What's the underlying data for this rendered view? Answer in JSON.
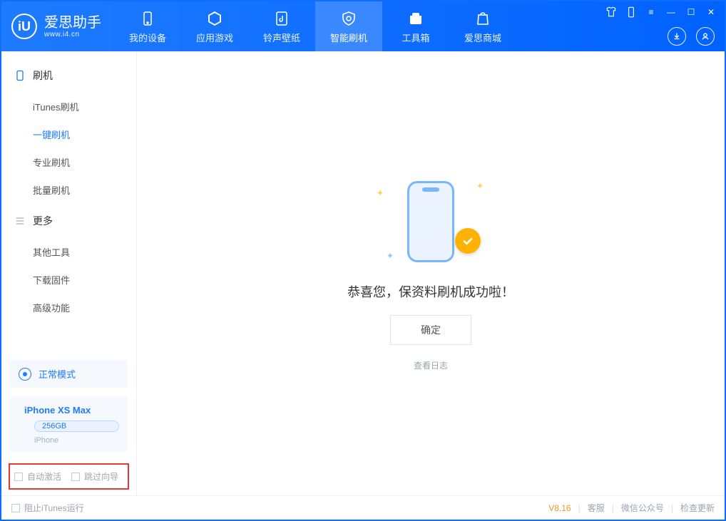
{
  "app": {
    "name": "爱思助手",
    "url": "www.i4.cn",
    "logo_letter": "iU"
  },
  "nav": {
    "items": [
      {
        "label": "我的设备",
        "icon": "phone-icon"
      },
      {
        "label": "应用游戏",
        "icon": "cube-icon"
      },
      {
        "label": "铃声壁纸",
        "icon": "music-icon"
      },
      {
        "label": "智能刷机",
        "icon": "refresh-shield-icon"
      },
      {
        "label": "工具箱",
        "icon": "toolbox-icon"
      },
      {
        "label": "爱思商城",
        "icon": "bag-icon"
      }
    ],
    "active_index": 3
  },
  "sidebar": {
    "group1_label": "刷机",
    "group1_items": [
      "iTunes刷机",
      "一键刷机",
      "专业刷机",
      "批量刷机"
    ],
    "group1_active_index": 1,
    "group2_label": "更多",
    "group2_items": [
      "其他工具",
      "下载固件",
      "高级功能"
    ]
  },
  "mode_card": {
    "label": "正常模式"
  },
  "device_card": {
    "name": "iPhone XS Max",
    "capacity": "256GB",
    "type": "iPhone"
  },
  "options": {
    "opt1": "自动激活",
    "opt2": "跳过向导"
  },
  "main": {
    "success_text": "恭喜您，保资料刷机成功啦！",
    "ok_button": "确定",
    "log_link": "查看日志"
  },
  "footer": {
    "block_itunes": "阻止iTunes运行",
    "version": "V8.16",
    "links": [
      "客服",
      "微信公众号",
      "检查更新"
    ]
  }
}
